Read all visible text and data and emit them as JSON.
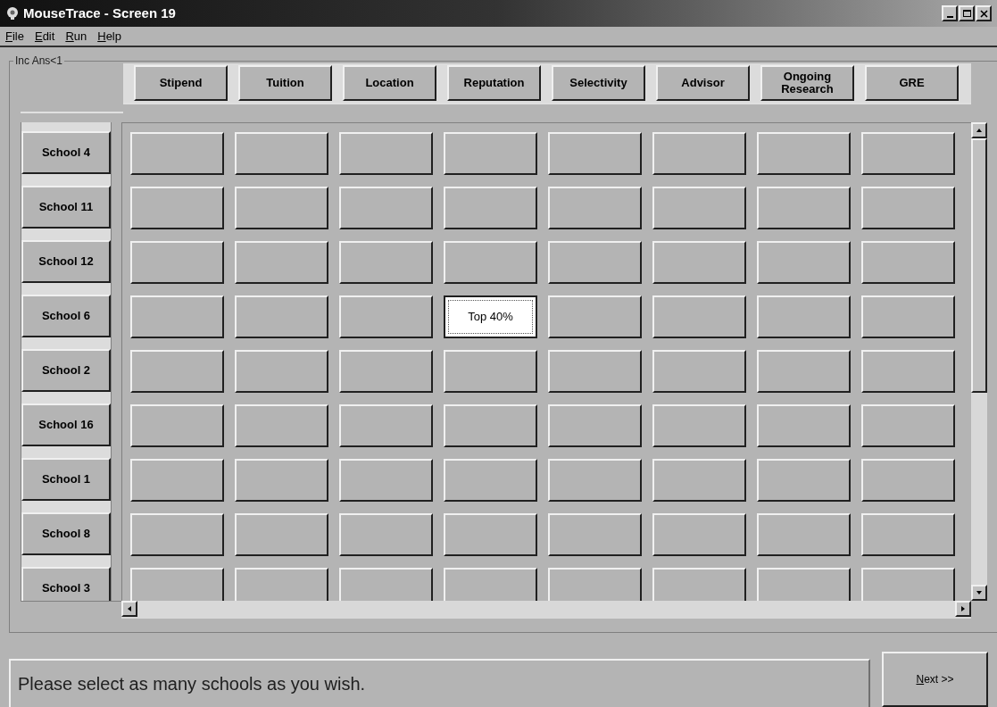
{
  "window": {
    "title": "MouseTrace - Screen 19"
  },
  "menu": [
    "File",
    "Edit",
    "Run",
    "Help"
  ],
  "group": {
    "label": "Inc Ans<1"
  },
  "columns": [
    "Stipend",
    "Tuition",
    "Location",
    "Reputation",
    "Selectivity",
    "Advisor",
    "Ongoing Research",
    "GRE"
  ],
  "rows": [
    {
      "label": "School 4",
      "cells": [
        {
          "opened": false
        },
        {
          "opened": false
        },
        {
          "opened": false
        },
        {
          "opened": false
        },
        {
          "opened": false
        },
        {
          "opened": false
        },
        {
          "opened": false
        },
        {
          "opened": false
        }
      ]
    },
    {
      "label": "School 11",
      "cells": [
        {
          "opened": false
        },
        {
          "opened": false
        },
        {
          "opened": false
        },
        {
          "opened": false
        },
        {
          "opened": false
        },
        {
          "opened": false
        },
        {
          "opened": false
        },
        {
          "opened": false
        }
      ]
    },
    {
      "label": "School 12",
      "cells": [
        {
          "opened": false
        },
        {
          "opened": false
        },
        {
          "opened": false
        },
        {
          "opened": false
        },
        {
          "opened": false
        },
        {
          "opened": false
        },
        {
          "opened": false
        },
        {
          "opened": false
        }
      ]
    },
    {
      "label": "School 6",
      "cells": [
        {
          "opened": false
        },
        {
          "opened": false
        },
        {
          "opened": false
        },
        {
          "opened": true,
          "text": "Top 40%"
        },
        {
          "opened": false
        },
        {
          "opened": false
        },
        {
          "opened": false
        },
        {
          "opened": false
        }
      ]
    },
    {
      "label": "School 2",
      "cells": [
        {
          "opened": false
        },
        {
          "opened": false
        },
        {
          "opened": false
        },
        {
          "opened": false
        },
        {
          "opened": false
        },
        {
          "opened": false
        },
        {
          "opened": false
        },
        {
          "opened": false
        }
      ]
    },
    {
      "label": "School 16",
      "cells": [
        {
          "opened": false
        },
        {
          "opened": false
        },
        {
          "opened": false
        },
        {
          "opened": false
        },
        {
          "opened": false
        },
        {
          "opened": false
        },
        {
          "opened": false
        },
        {
          "opened": false
        }
      ]
    },
    {
      "label": "School 1",
      "cells": [
        {
          "opened": false
        },
        {
          "opened": false
        },
        {
          "opened": false
        },
        {
          "opened": false
        },
        {
          "opened": false
        },
        {
          "opened": false
        },
        {
          "opened": false
        },
        {
          "opened": false
        }
      ]
    },
    {
      "label": "School 8",
      "cells": [
        {
          "opened": false
        },
        {
          "opened": false
        },
        {
          "opened": false
        },
        {
          "opened": false
        },
        {
          "opened": false
        },
        {
          "opened": false
        },
        {
          "opened": false
        },
        {
          "opened": false
        }
      ]
    },
    {
      "label": "School 3",
      "cells": [
        {
          "opened": false
        },
        {
          "opened": false
        },
        {
          "opened": false
        },
        {
          "opened": false
        },
        {
          "opened": false
        },
        {
          "opened": false
        },
        {
          "opened": false
        },
        {
          "opened": false
        }
      ]
    }
  ],
  "message": "Please select as many schools as you wish.",
  "next_button": "Next >>"
}
